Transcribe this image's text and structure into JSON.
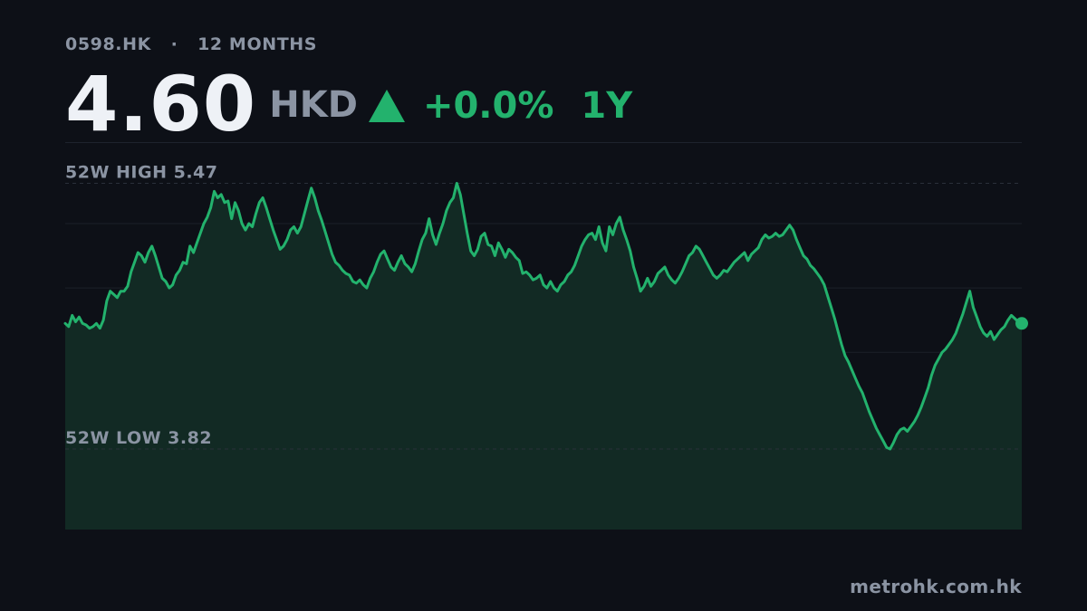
{
  "header": {
    "ticker": "0598.HK",
    "separator": "·",
    "period_label": "12 MONTHS",
    "price": "4.60",
    "currency": "HKD",
    "change": "+0.0%",
    "change_period": "1Y",
    "trend_icon": "triangle-up-icon"
  },
  "footer": {
    "source": "metrohk.com.hk"
  },
  "colors": {
    "background": "#0d1017",
    "line": "#23b26d",
    "fill": "#122a24",
    "muted_text": "#8b94a3",
    "price_text": "#eef1f6"
  },
  "chart_data": {
    "type": "area",
    "title": "",
    "xlabel": "",
    "ylabel": "",
    "ylim": [
      3.32,
      5.72
    ],
    "grid": true,
    "reference_lines": [
      {
        "label": "52W HIGH",
        "value": 5.47,
        "value_text": "5.47"
      },
      {
        "label": "52W LOW",
        "value": 3.82,
        "value_text": "3.82"
      }
    ],
    "series": [
      {
        "values": [
          4.6,
          4.58,
          4.65,
          4.61,
          4.64,
          4.6,
          4.59,
          4.57,
          4.58,
          4.6,
          4.57,
          4.62,
          4.74,
          4.8,
          4.78,
          4.76,
          4.8,
          4.8,
          4.83,
          4.92,
          4.98,
          5.04,
          5.02,
          4.98,
          5.04,
          5.08,
          5.02,
          4.95,
          4.88,
          4.86,
          4.82,
          4.84,
          4.9,
          4.93,
          4.98,
          4.97,
          5.08,
          5.04,
          5.1,
          5.16,
          5.22,
          5.26,
          5.32,
          5.42,
          5.38,
          5.4,
          5.35,
          5.36,
          5.25,
          5.35,
          5.3,
          5.22,
          5.18,
          5.22,
          5.2,
          5.28,
          5.35,
          5.38,
          5.32,
          5.25,
          5.18,
          5.12,
          5.06,
          5.08,
          5.12,
          5.18,
          5.2,
          5.16,
          5.2,
          5.28,
          5.36,
          5.44,
          5.38,
          5.3,
          5.24,
          5.17,
          5.1,
          5.03,
          4.98,
          4.96,
          4.93,
          4.91,
          4.9,
          4.86,
          4.85,
          4.87,
          4.84,
          4.82,
          4.88,
          4.92,
          4.98,
          5.03,
          5.05,
          5.0,
          4.95,
          4.93,
          4.98,
          5.02,
          4.97,
          4.95,
          4.92,
          4.97,
          5.05,
          5.12,
          5.16,
          5.25,
          5.15,
          5.09,
          5.16,
          5.22,
          5.3,
          5.35,
          5.38,
          5.47,
          5.4,
          5.28,
          5.16,
          5.05,
          5.02,
          5.06,
          5.14,
          5.16,
          5.09,
          5.08,
          5.02,
          5.1,
          5.06,
          5.01,
          5.06,
          5.04,
          5.01,
          4.99,
          4.91,
          4.92,
          4.9,
          4.87,
          4.88,
          4.9,
          4.84,
          4.82,
          4.86,
          4.82,
          4.8,
          4.84,
          4.86,
          4.9,
          4.92,
          4.96,
          5.02,
          5.08,
          5.12,
          5.15,
          5.16,
          5.12,
          5.2,
          5.1,
          5.05,
          5.2,
          5.15,
          5.22,
          5.26,
          5.18,
          5.12,
          5.05,
          4.95,
          4.88,
          4.8,
          4.83,
          4.88,
          4.83,
          4.86,
          4.91,
          4.93,
          4.95,
          4.9,
          4.87,
          4.85,
          4.88,
          4.92,
          4.97,
          5.02,
          5.04,
          5.08,
          5.06,
          5.02,
          4.98,
          4.94,
          4.9,
          4.88,
          4.9,
          4.93,
          4.92,
          4.95,
          4.98,
          5.0,
          5.02,
          5.04,
          4.99,
          5.03,
          5.05,
          5.07,
          5.12,
          5.15,
          5.13,
          5.14,
          5.16,
          5.14,
          5.15,
          5.18,
          5.21,
          5.18,
          5.12,
          5.07,
          5.02,
          5.0,
          4.96,
          4.94,
          4.91,
          4.88,
          4.84,
          4.77,
          4.7,
          4.63,
          4.55,
          4.47,
          4.4,
          4.36,
          4.31,
          4.26,
          4.21,
          4.17,
          4.11,
          4.05,
          4.0,
          3.95,
          3.91,
          3.87,
          3.83,
          3.82,
          3.86,
          3.91,
          3.94,
          3.95,
          3.93,
          3.96,
          3.99,
          4.03,
          4.08,
          4.14,
          4.2,
          4.28,
          4.34,
          4.38,
          4.42,
          4.44,
          4.47,
          4.5,
          4.54,
          4.6,
          4.66,
          4.73,
          4.8,
          4.7,
          4.64,
          4.58,
          4.54,
          4.52,
          4.55,
          4.5,
          4.53,
          4.56,
          4.58,
          4.62,
          4.65,
          4.63,
          4.61,
          4.6
        ]
      }
    ]
  }
}
